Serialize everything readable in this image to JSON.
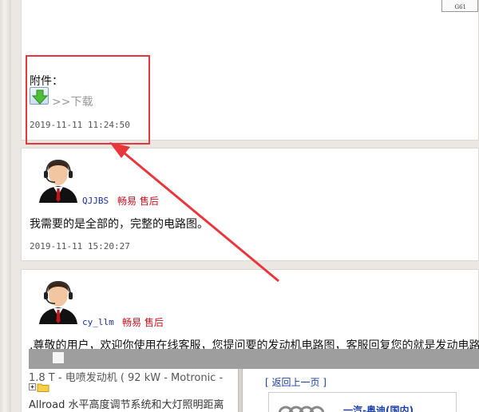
{
  "post1": {
    "attachment_label": "附件：",
    "download_label": ">>下载",
    "timestamp": "2019-11-11 11:24:50",
    "figure_label": "G61"
  },
  "post2": {
    "username": "QJJBS",
    "tags": "畅易 售后",
    "message": "我需要的是全部的，完整的电路图。",
    "timestamp": "2019-11-11 15:20:27"
  },
  "post3": {
    "username": "cy_llm",
    "tags": "畅易 售后",
    "message": ".尊敬的用户，欢迎你使用在线客服，您提问要的发动机电路图，客服回复您的就是发动电路"
  },
  "embed": {
    "left_row1": "1.8 T - 电喷发动机 ( 92 kW - Motronic -",
    "left_row2": "Allroad 水平高度调节系统和大灯照明距离",
    "back_link": "[ 返回上一页 ]",
    "brand_title": "一汽-奥迪(国内)"
  },
  "colors": {
    "highlight": "#e8373a",
    "link_blue": "#1b2ea6",
    "tag_red": "#c1121f"
  }
}
